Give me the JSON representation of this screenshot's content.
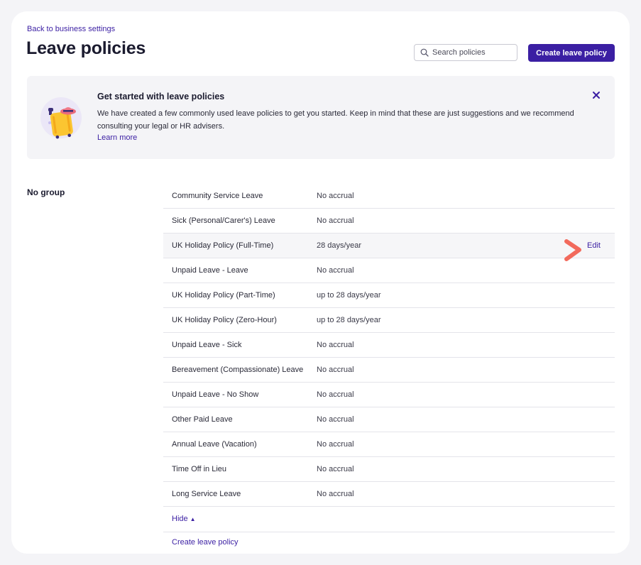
{
  "header": {
    "back_link": "Back to business settings",
    "title": "Leave policies",
    "search_placeholder": "Search policies",
    "create_button": "Create leave policy"
  },
  "banner": {
    "title": "Get started with leave policies",
    "text": "We have created a few commonly used leave policies to get you started. Keep in mind that these are just suggestions and we recommend consulting your legal or HR advisers.",
    "link": "Learn more",
    "illustration": "suitcase-icon",
    "close_icon": "close-icon"
  },
  "group": {
    "label": "No group",
    "policies": [
      {
        "name": "Community Service Leave",
        "accrual": "No accrual"
      },
      {
        "name": "Sick (Personal/Carer's) Leave",
        "accrual": "No accrual"
      },
      {
        "name": "UK Holiday Policy (Full-Time)",
        "accrual": "28 days/year",
        "action": "Edit"
      },
      {
        "name": "Unpaid Leave - Leave",
        "accrual": "No accrual"
      },
      {
        "name": "UK Holiday Policy (Part-Time)",
        "accrual": "up to 28 days/year"
      },
      {
        "name": "UK Holiday Policy (Zero-Hour)",
        "accrual": "up to 28 days/year"
      },
      {
        "name": "Unpaid Leave - Sick",
        "accrual": "No accrual"
      },
      {
        "name": "Bereavement (Compassionate) Leave",
        "accrual": "No accrual"
      },
      {
        "name": "Unpaid Leave - No Show",
        "accrual": "No accrual"
      },
      {
        "name": "Other Paid Leave",
        "accrual": "No accrual"
      },
      {
        "name": "Annual Leave (Vacation)",
        "accrual": "No accrual"
      },
      {
        "name": "Time Off in Lieu",
        "accrual": "No accrual"
      },
      {
        "name": "Long Service Leave",
        "accrual": "No accrual"
      }
    ],
    "hide_label": "Hide",
    "hide_caret": "▲",
    "create_link": "Create leave policy"
  },
  "colors": {
    "accent": "#3b1fa3",
    "arrow_annotation": "#f26a5c"
  }
}
